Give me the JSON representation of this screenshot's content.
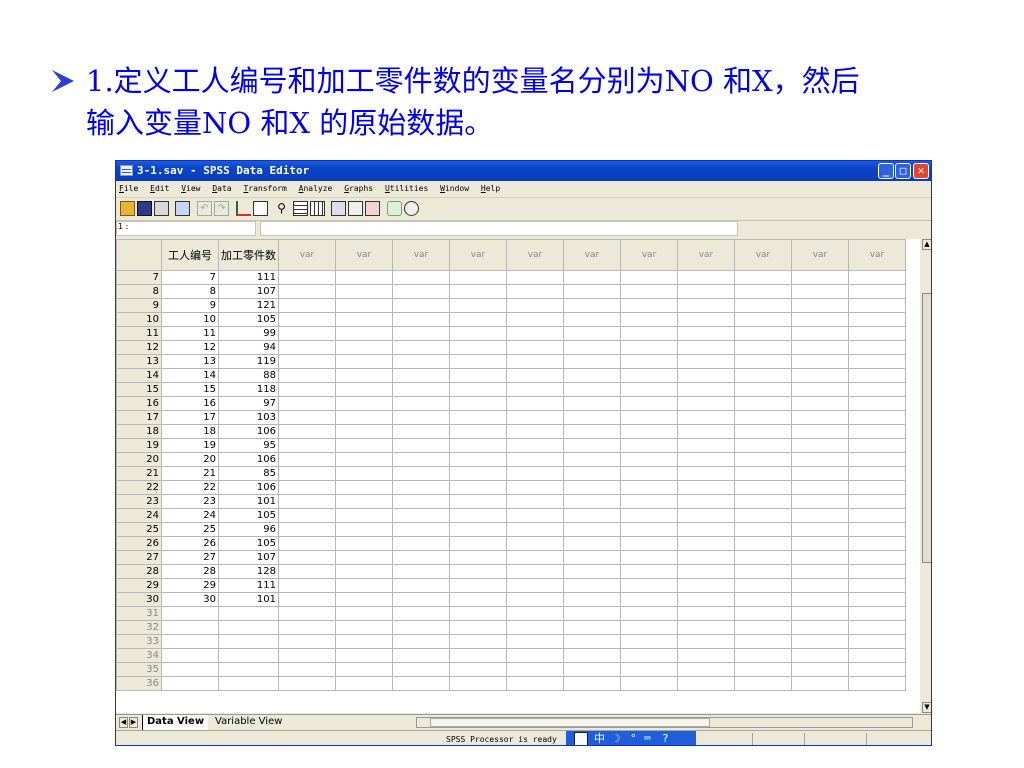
{
  "slide": {
    "heading_line1": "1.定义工人编号和加工零件数的变量名分别为NO 和X，然后",
    "heading_line2": "输入变量NO 和X 的原始数据。"
  },
  "window": {
    "title": "3-1.sav - SPSS Data Editor",
    "min_label": "_",
    "max_label": "□",
    "close_label": "✕"
  },
  "menu": [
    "File",
    "Edit",
    "View",
    "Data",
    "Transform",
    "Analyze",
    "Graphs",
    "Utilities",
    "Window",
    "Help"
  ],
  "toolbar_icons": [
    "open-icon",
    "save-icon",
    "print-icon",
    "dialog-recall-icon",
    "undo-icon",
    "redo-icon",
    "goto-chart-icon",
    "goto-case-icon",
    "find-icon",
    "insert-case-icon",
    "insert-variable-icon",
    "split-file-icon",
    "weight-cases-icon",
    "select-cases-icon",
    "value-labels-icon",
    "use-sets-icon"
  ],
  "cell_editor": {
    "reference": "1 :",
    "value": ""
  },
  "sheet": {
    "headers": [
      "工人编号",
      "加工零件数",
      "var",
      "var",
      "var",
      "var",
      "var",
      "var",
      "var",
      "var",
      "var",
      "var",
      "var"
    ],
    "rows": [
      {
        "row": "7",
        "no": "7",
        "x": "111"
      },
      {
        "row": "8",
        "no": "8",
        "x": "107"
      },
      {
        "row": "9",
        "no": "9",
        "x": "121"
      },
      {
        "row": "10",
        "no": "10",
        "x": "105"
      },
      {
        "row": "11",
        "no": "11",
        "x": "99"
      },
      {
        "row": "12",
        "no": "12",
        "x": "94"
      },
      {
        "row": "13",
        "no": "13",
        "x": "119"
      },
      {
        "row": "14",
        "no": "14",
        "x": "88"
      },
      {
        "row": "15",
        "no": "15",
        "x": "118"
      },
      {
        "row": "16",
        "no": "16",
        "x": "97"
      },
      {
        "row": "17",
        "no": "17",
        "x": "103"
      },
      {
        "row": "18",
        "no": "18",
        "x": "106"
      },
      {
        "row": "19",
        "no": "19",
        "x": "95"
      },
      {
        "row": "20",
        "no": "20",
        "x": "106"
      },
      {
        "row": "21",
        "no": "21",
        "x": "85"
      },
      {
        "row": "22",
        "no": "22",
        "x": "106"
      },
      {
        "row": "23",
        "no": "23",
        "x": "101"
      },
      {
        "row": "24",
        "no": "24",
        "x": "105"
      },
      {
        "row": "25",
        "no": "25",
        "x": "96"
      },
      {
        "row": "26",
        "no": "26",
        "x": "105"
      },
      {
        "row": "27",
        "no": "27",
        "x": "107"
      },
      {
        "row": "28",
        "no": "28",
        "x": "128"
      },
      {
        "row": "29",
        "no": "29",
        "x": "111"
      },
      {
        "row": "30",
        "no": "30",
        "x": "101"
      },
      {
        "row": "31",
        "no": "",
        "x": ""
      },
      {
        "row": "32",
        "no": "",
        "x": ""
      },
      {
        "row": "33",
        "no": "",
        "x": ""
      },
      {
        "row": "34",
        "no": "",
        "x": ""
      },
      {
        "row": "35",
        "no": "",
        "x": ""
      },
      {
        "row": "36",
        "no": "",
        "x": ""
      }
    ]
  },
  "tabs": {
    "data_view": "Data View",
    "variable_view": "Variable View"
  },
  "status": {
    "processor": "SPSS Processor  is ready",
    "ime_label": "中"
  }
}
